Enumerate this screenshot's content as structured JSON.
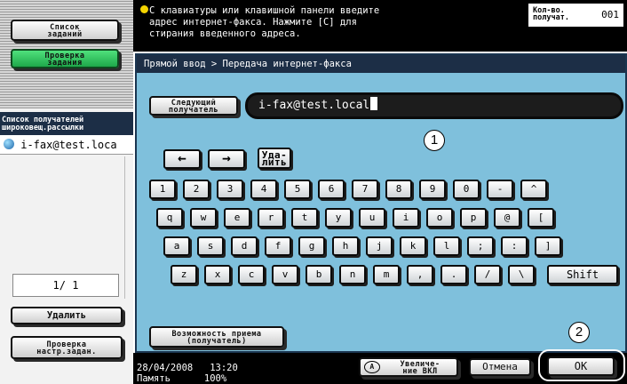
{
  "left_panel": {
    "job_list_label": "Список\nзаданий",
    "check_job_label": "Проверка\nзадания",
    "recipient_list_label": "Список получателей\nшироковещ.рассылки",
    "recipient_item": "i-fax@test.loca",
    "page_counter": "1/ 1",
    "delete_label": "Удалить",
    "check_settings_label": "Проверка\nнастр.задан."
  },
  "message": {
    "text": "С клавиатуры или клавишной панели введите\nадрес интернет-факса. Нажмите [C] для\nстирания введенного адреса.",
    "copies_label": "Кол-во.\nполучат.",
    "copies_value": "001"
  },
  "main": {
    "breadcrumb": "Прямой ввод > Передача интернет-факса",
    "next_recipient_label": "Следующий\nполучатель",
    "address_value": "i-fax@test.local",
    "callout_1": "1",
    "callout_2": "2",
    "left_arrow": "←",
    "right_arrow": "→",
    "delete_label": "Уда-\nлить",
    "keys_row1": [
      "1",
      "2",
      "3",
      "4",
      "5",
      "6",
      "7",
      "8",
      "9",
      "0",
      "-",
      "^"
    ],
    "keys_row2": [
      "q",
      "w",
      "e",
      "r",
      "t",
      "y",
      "u",
      "i",
      "o",
      "p",
      "@",
      "["
    ],
    "keys_row3": [
      "a",
      "s",
      "d",
      "f",
      "g",
      "h",
      "j",
      "k",
      "l",
      ";",
      ":",
      "]"
    ],
    "keys_row4": [
      "z",
      "x",
      "c",
      "v",
      "b",
      "n",
      "m",
      ",",
      ".",
      "/",
      "\\"
    ],
    "shift_label": "Shift",
    "reception_label": "Возможность приема\n(получатель)"
  },
  "bottom": {
    "date": "28/04/2008",
    "time": "13:20",
    "memory_label": "Память",
    "memory_value": "100%",
    "zoom_label": "Увеличе-\nние ВКЛ",
    "cancel_label": "Отмена",
    "ok_label": "OK"
  }
}
